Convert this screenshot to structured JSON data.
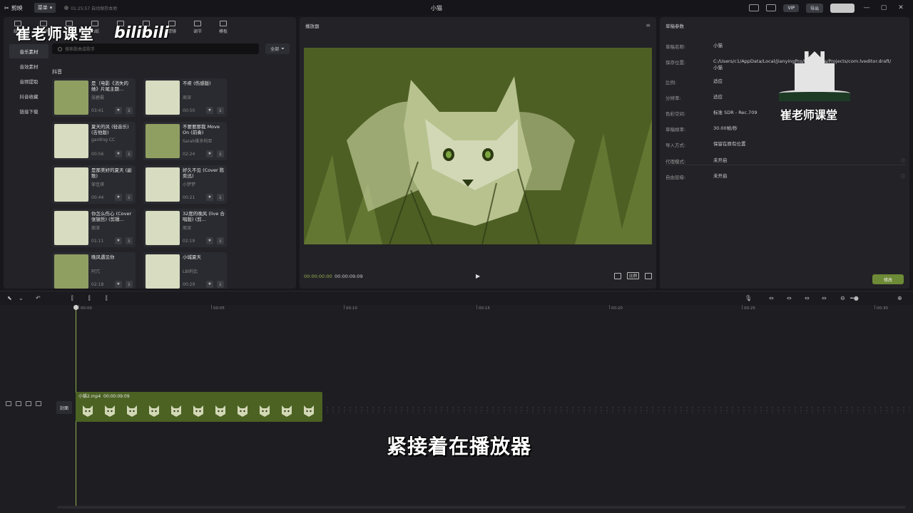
{
  "titlebar": {
    "app_name": "剪映",
    "menu_label": "菜单",
    "autosave": "01:25:57 自动保存本地",
    "window_title": "小猫",
    "vip_label": "VIP",
    "export_label": "导出"
  },
  "media": {
    "tabs": [
      {
        "label": "媒体",
        "icon": "media-icon"
      },
      {
        "label": "音频",
        "icon": "music-icon"
      },
      {
        "label": "文本",
        "icon": "text-icon"
      },
      {
        "label": "贴纸",
        "icon": "sticker-icon"
      },
      {
        "label": "特效",
        "icon": "effects-icon"
      },
      {
        "label": "转场",
        "icon": "transition-icon"
      },
      {
        "label": "滤镜",
        "icon": "filter-icon"
      },
      {
        "label": "调节",
        "icon": "adjust-icon"
      },
      {
        "label": "模板",
        "icon": "template-icon"
      }
    ],
    "sidebar": [
      {
        "label": "音乐素材",
        "active": true
      },
      {
        "label": "音效素材",
        "active": false
      },
      {
        "label": "音频提取",
        "active": false
      },
      {
        "label": "抖音收藏",
        "active": false
      },
      {
        "label": "链接下载",
        "active": false
      }
    ],
    "search_placeholder": "搜索歌曲或歌手",
    "filter_label": "全部",
    "section_title": "抖音",
    "songs": [
      {
        "title": "是（电影《消失的她》片尾主题...",
        "artist": "张碧晨",
        "duration": "03:41",
        "thumb": "mid"
      },
      {
        "title": "不疼 (伤感版)",
        "artist": "周深",
        "duration": "00:50",
        "thumb": "light"
      },
      {
        "title": "夏天的风 (轻音乐) (吉他版)",
        "artist": "garding CC",
        "duration": "00:56",
        "thumb": "light"
      },
      {
        "title": "不要要那我 Move On (前奏)",
        "artist": "Sarah维多利亚",
        "duration": "02:24",
        "thumb": "mid"
      },
      {
        "title": "是那美好的夏天 (副歌)",
        "artist": "邹佳琪",
        "duration": "00:44",
        "thumb": "light"
      },
      {
        "title": "好久不见 (Cover 陈奕迅)",
        "artist": "小梦梦",
        "duration": "00:21",
        "thumb": "light"
      },
      {
        "title": "你怎么伤心 (Cover 张镐哲) (剪辑...",
        "artist": "周深",
        "duration": "01:11",
        "thumb": "light"
      },
      {
        "title": "32度的晚风 (live 合唱版) (剪...",
        "artist": "周深",
        "duration": "02:19",
        "thumb": "light"
      },
      {
        "title": "晚风遇见你",
        "artist": "阿冗",
        "duration": "02:18",
        "thumb": "mid"
      },
      {
        "title": "小城夏天",
        "artist": "LBI利比",
        "duration": "00:29",
        "thumb": "light"
      }
    ]
  },
  "watermark": {
    "left_text": "崔老师课堂",
    "bili_text": "bilibili",
    "right_text": "崔老师课堂"
  },
  "player": {
    "title": "播放器",
    "current_time": "00:00:00:00",
    "total_time": "00:00:09:09",
    "ratio_label": "比例"
  },
  "props": {
    "title": "草稿参数",
    "rows": [
      {
        "key": "草稿名称:",
        "value": "小猫"
      },
      {
        "key": "保存位置:",
        "value": "C:/Users/c1/AppData/Local/JianyingPro/User Data/Projects/com.lveditor.draft/小猫"
      },
      {
        "key": "比例:",
        "value": "适应"
      },
      {
        "key": "分辨率:",
        "value": "适应"
      },
      {
        "key": "色彩空间:",
        "value": "标准 SDR - Rec.709"
      },
      {
        "key": "草稿帧率:",
        "value": "30.00帧/秒"
      },
      {
        "key": "导入方式:",
        "value": "保留在原有位置"
      }
    ],
    "rows2": [
      {
        "key": "代理模式:",
        "value": "未开启"
      },
      {
        "key": "自由层级:",
        "value": "未开启"
      }
    ],
    "modify_label": "修改"
  },
  "timeline": {
    "ticks": [
      "00:00",
      "00:05",
      "00:10",
      "00:15",
      "00:20",
      "00:25",
      "00:30"
    ],
    "cover_label": "封面",
    "clip_name": "小猫2.mp4",
    "clip_duration": "00:00:09:09"
  },
  "subtitle": "紧接着在播放器",
  "colors": {
    "accent": "#8fb04a",
    "clip": "#4b6223",
    "video_bg": "#4e5f24"
  }
}
